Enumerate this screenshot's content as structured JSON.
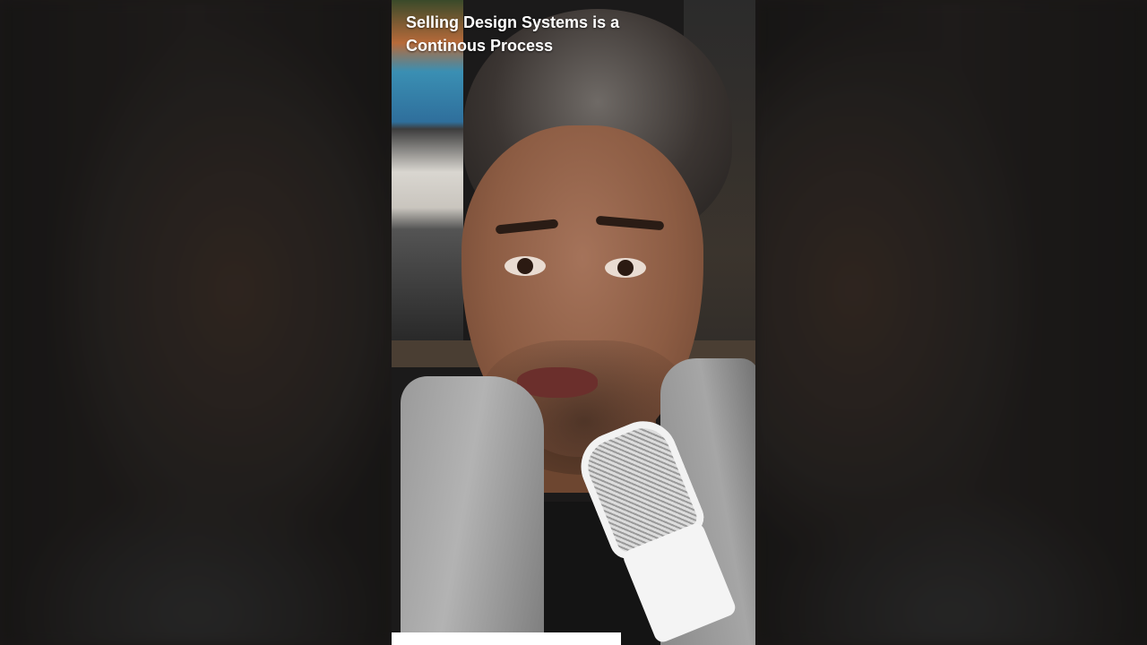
{
  "video": {
    "caption_line1": "Selling Design Systems is a",
    "caption_line2": "Continous Process"
  },
  "colors": {
    "background": "#2a2624",
    "caption_text": "#ffffff"
  }
}
